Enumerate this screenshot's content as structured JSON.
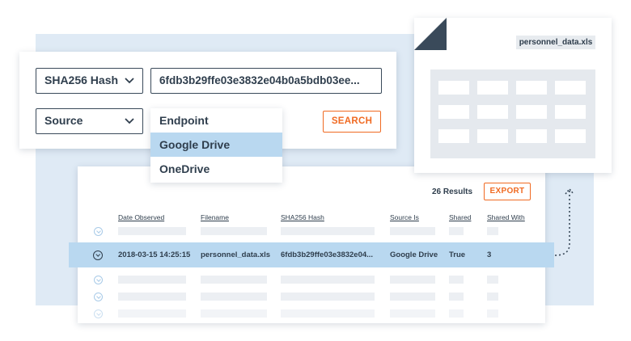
{
  "search": {
    "hash_type_label": "SHA256 Hash",
    "hash_value": "6fdb3b29ffe03e3832e04b0a5bdb03ee...",
    "source_label": "Source",
    "search_label": "SEARCH",
    "dropdown_options": [
      "Endpoint",
      "Google Drive",
      "OneDrive"
    ],
    "selected_option": "Google Drive"
  },
  "file": {
    "name": "personnel_data.xls"
  },
  "results": {
    "count_label": "26 Results",
    "export_label": "EXPORT",
    "columns": [
      "Date Observed",
      "Filename",
      "SHA256 Hash",
      "Source Is",
      "Shared",
      "Shared With"
    ],
    "highlight_row": {
      "date": "2018-03-15 14:25:15",
      "filename": "personnel_data.xls",
      "hash": "6fdb3b29ffe03e3832e04...",
      "source": "Google Drive",
      "shared": "True",
      "shared_with": "3"
    }
  },
  "colors": {
    "accent_orange": "#f06a22",
    "highlight_blue": "#b9d8f0",
    "background_panel": "#dfeaf5",
    "text_dark": "#2f3e4d"
  },
  "icons": {
    "select_chevron": "chevron-down-icon",
    "row_toggle": "expand-circle-icon",
    "connector": "dotted-arrow-up-icon"
  }
}
